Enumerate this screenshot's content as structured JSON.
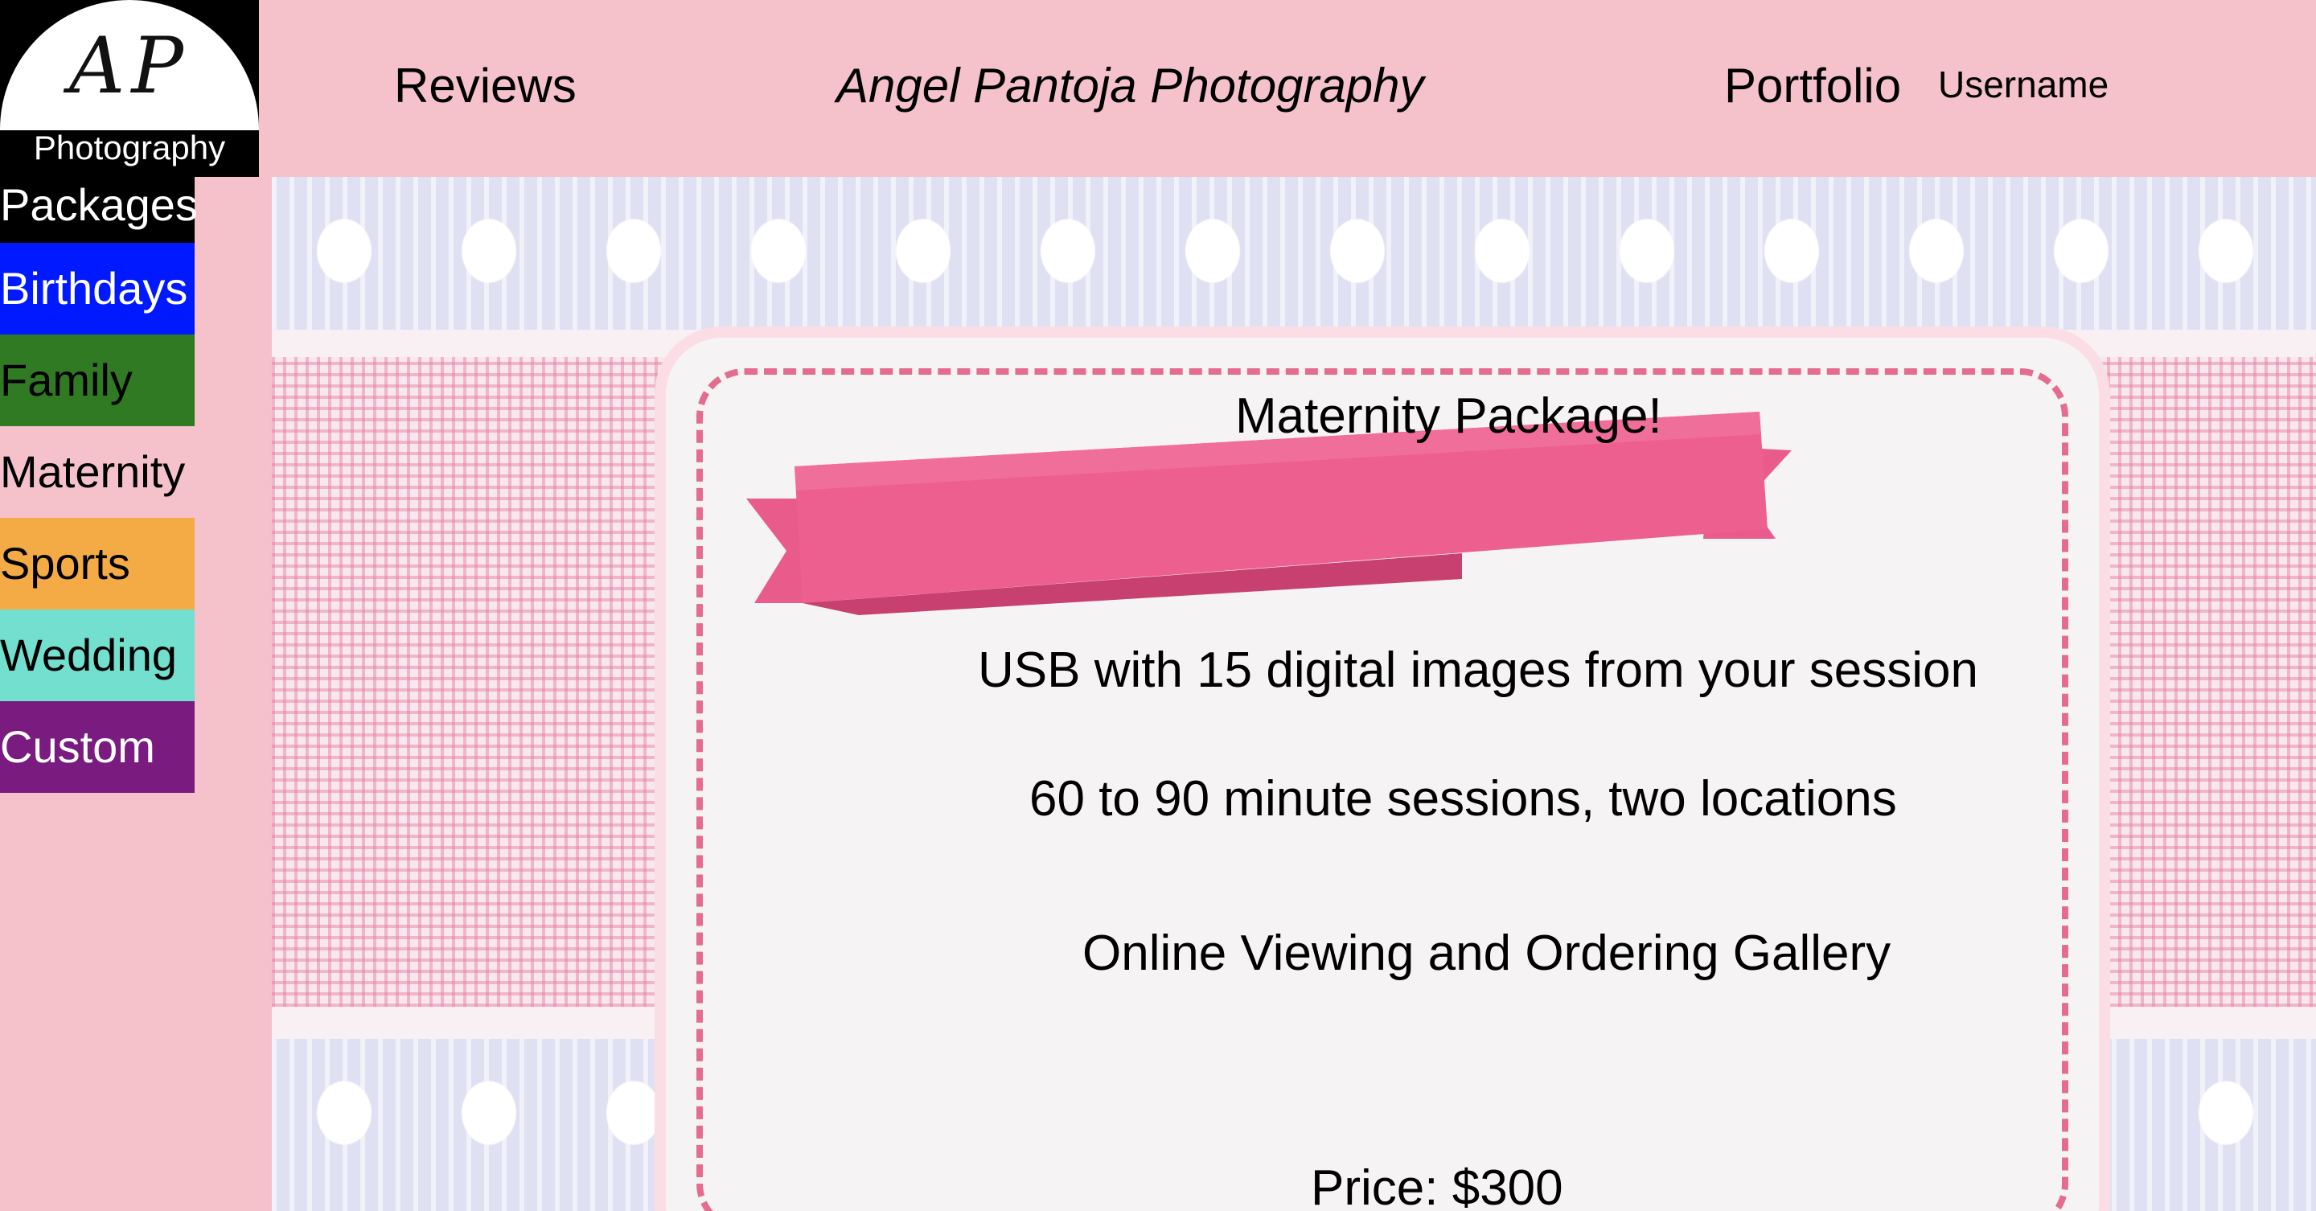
{
  "logo": {
    "monogram": "AP",
    "subtitle": "Photography"
  },
  "header": {
    "reviews_label": "Reviews",
    "site_title": "Angel Pantoja Photography",
    "portfolio_label": "Portfolio",
    "username_label": "Username"
  },
  "sidebar": {
    "heading": "Packages",
    "items": [
      {
        "label": "Birthdays",
        "bg": "#0019ff",
        "fg": "#ffffff"
      },
      {
        "label": "Family",
        "bg": "#2f7a23",
        "fg": "#000000"
      },
      {
        "label": "Maternity",
        "bg": "#f5c2cb",
        "fg": "#000000"
      },
      {
        "label": "Sports",
        "bg": "#f4aa45",
        "fg": "#000000"
      },
      {
        "label": "Wedding",
        "bg": "#72dfcf",
        "fg": "#000000"
      },
      {
        "label": "Custom",
        "bg": "#7a1b7f",
        "fg": "#ffffff"
      }
    ]
  },
  "package": {
    "title": "Maternity Package!",
    "features": [
      "USB with 15 digital images from your session",
      "60 to 90 minute sessions, two locations",
      "Online Viewing and Ordering Gallery"
    ],
    "price": "Price: $300"
  },
  "colors": {
    "page_bg": "#f5c2cb",
    "ribbon": "#e95b8a",
    "dash": "#e36c8f"
  }
}
